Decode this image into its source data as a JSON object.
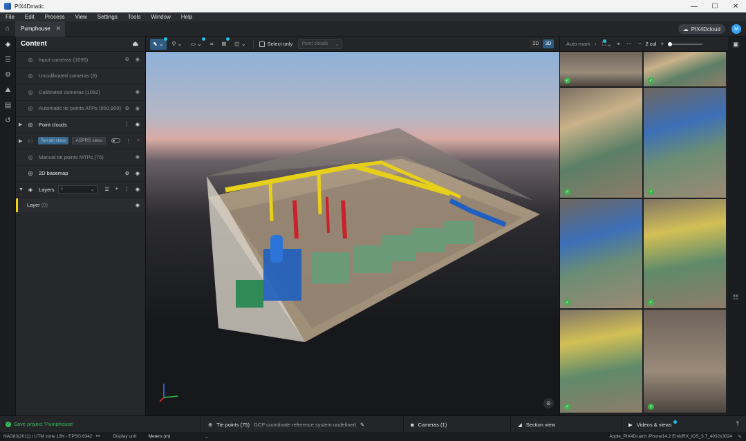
{
  "window": {
    "title": "PIX4Dmatic",
    "controls": [
      "—",
      "☐",
      "✕"
    ]
  },
  "menu": [
    "File",
    "Edit",
    "Process",
    "View",
    "Settings",
    "Tools",
    "Window",
    "Help"
  ],
  "tabs": {
    "project": "Pumphouse",
    "cloud_button": "PIX4Dcloud",
    "avatar": "M"
  },
  "content_panel": {
    "title": "Content",
    "items": [
      {
        "label": "Input cameras (1095)",
        "icon": "camera-icon",
        "actions": [
          "⚙",
          "◉"
        ],
        "bright": false,
        "caret": ""
      },
      {
        "label": "Uncalibrated cameras (3)",
        "icon": "camera-outline-icon",
        "actions": [],
        "bright": false,
        "caret": ""
      },
      {
        "label": "Calibrated cameras (1092)",
        "icon": "camera-check-icon",
        "actions": [
          "◉"
        ],
        "bright": false,
        "caret": ""
      },
      {
        "label": "Automatic tie points ATPs (850,909)",
        "icon": "tie-points-icon",
        "actions": [
          "⚙",
          "◉"
        ],
        "bright": false,
        "caret": ""
      },
      {
        "label": "Point clouds",
        "icon": "point-cloud-icon",
        "actions": [
          "⋮",
          "◉"
        ],
        "bright": true,
        "caret": "▶"
      }
    ],
    "class_row": {
      "chip_active": "Terrain class",
      "chip_inactive": "ASPRS class"
    },
    "items_after": [
      {
        "label": "Manual tie points MTPs (75)",
        "icon": "mtp-icon",
        "actions": [
          "◉"
        ],
        "bright": false,
        "caret": ""
      },
      {
        "label": "2D basemap",
        "icon": "map-icon",
        "actions": [
          "⚙",
          "◉"
        ],
        "bright": true,
        "caret": ""
      }
    ],
    "layers": {
      "label": "Layers",
      "search_icon": "⌕",
      "layer_name": "Layer",
      "layer_count": "(0)"
    }
  },
  "viewport": {
    "toolbar": {
      "select_only_label": "Select only",
      "point_clouds_placeholder": "Point clouds",
      "view_2d": "2D",
      "view_3d": "3D"
    }
  },
  "images_panel": {
    "auto_mark": "Auto-mark",
    "columns": "2 col",
    "minus": "−",
    "plus": "+"
  },
  "dock": {
    "save_status": "Save project 'Pumphouse'",
    "tie_points": "Tie points (75)",
    "gcp_note": "GCP coordinate reference system undefined",
    "cameras": "Cameras (1)",
    "section_view": "Section view",
    "videos": "Videos & views"
  },
  "status": {
    "crs": "NAD83(2011) / UTM zone 13N - EPSG:6342",
    "crs_more": "•••",
    "display_unit_label": "Display unit:",
    "display_unit": "Meters (m)",
    "camera_info": "Apple_PIX4Dcatch iPhone14.2 EmidRX_iOS_3.7_4032x3024"
  }
}
